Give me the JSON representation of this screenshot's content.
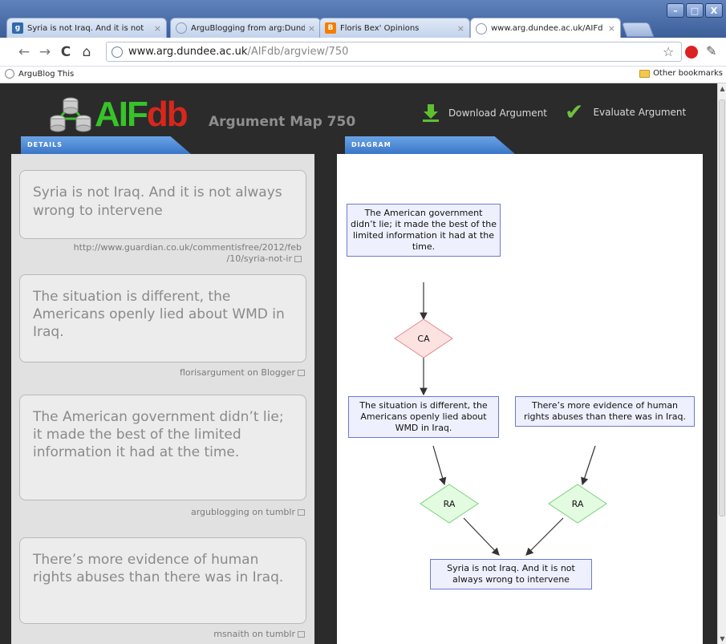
{
  "browser": {
    "tabs": [
      {
        "label": "Syria is not Iraq. And it is not",
        "icon": "guardian-favicon",
        "icon_color": "#2f6ba9"
      },
      {
        "label": "ArguBlogging from arg:Dunde",
        "icon": "globe-favicon",
        "icon_color": "#8a98b3"
      },
      {
        "label": "Floris Bex' Opinions",
        "icon": "blogger-favicon",
        "icon_color": "#f57d00"
      },
      {
        "label": "www.arg.dundee.ac.uk/AIFd",
        "icon": "globe-favicon",
        "icon_color": "#8a98b3"
      }
    ],
    "window_buttons": {
      "minimize": "–",
      "maximize": "□",
      "close": "X"
    },
    "url_host": "www.arg.dundee.ac.uk",
    "url_path": "/AIFdb/argview/750",
    "bookmark_left": "ArguBlog This",
    "bookmark_right": "Other bookmarks"
  },
  "header": {
    "logo_text_main": "AIF",
    "logo_text_accent": "db",
    "map_title": "Argument Map 750",
    "download_label": "Download Argument",
    "evaluate_label": "Evaluate Argument"
  },
  "sections": {
    "details_label": "DETAILS",
    "diagram_label": "DIAGRAM"
  },
  "details": {
    "cards": [
      {
        "text": "Syria is not Iraq. And it is not always wrong to intervene",
        "source": "http://www.guardian.co.uk/commentisfree/2012/feb/10/syria-not-ir",
        "source_line1": "http://www.guardian.co.uk/commentisfree/2012/feb",
        "source_line2": "/10/syria-not-ir"
      },
      {
        "text": "The situation is different, the Americans openly lied about WMD in Iraq.",
        "source": "florisargument on Blogger"
      },
      {
        "text": "The American government didn’t lie; it made the best of the limited information it had at the time.",
        "source": "argublogging on tumblr"
      },
      {
        "text": "There’s more evidence of human rights abuses than there was in Iraq.",
        "source": "msnaith on tumblr"
      }
    ]
  },
  "diagram": {
    "nodes": {
      "gov": "The American government didn’t lie; it made the best of the limited information it had at the time.",
      "situation": "The situation is different, the Americans openly lied about WMD in Iraq.",
      "evidence": "There’s more evidence of human rights abuses than there was in Iraq.",
      "conclusion": "Syria is not Iraq. And it is not always wrong to intervene"
    },
    "ca_label": "CA",
    "ra_left_label": "RA",
    "ra_right_label": "RA",
    "colors": {
      "i_node_fill": "#eef0fd",
      "i_node_border": "#6b7bcf",
      "ca_fill": "#fde2e2",
      "ca_border": "#e08a8a",
      "ra_fill": "#e3fbe0",
      "ra_border": "#7ad27a"
    }
  },
  "theme": {
    "logo_green": "#36c429",
    "logo_red": "#d9261c",
    "section_tab_blue": "#3a76c8",
    "check_green": "#6fc03b"
  }
}
